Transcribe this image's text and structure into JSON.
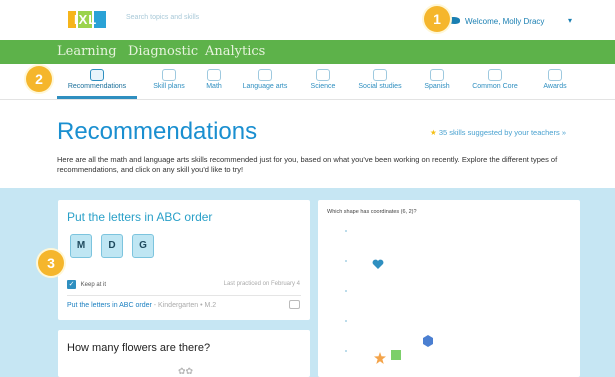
{
  "header": {
    "logo_text": "IXL",
    "search_placeholder": "Search topics and skills",
    "welcome_text": "Welcome, Molly Dracy",
    "caret": "▾"
  },
  "nav": {
    "items": [
      "Learning",
      "Diagnostic",
      "Analytics"
    ]
  },
  "subjects": {
    "items": [
      {
        "label": "Recommendations",
        "icon": "recommendations-icon"
      },
      {
        "label": "Skill plans",
        "icon": "skill-plans-icon"
      },
      {
        "label": "Math",
        "icon": "math-icon"
      },
      {
        "label": "Language arts",
        "icon": "language-arts-icon"
      },
      {
        "label": "Science",
        "icon": "science-icon"
      },
      {
        "label": "Social studies",
        "icon": "social-studies-icon"
      },
      {
        "label": "Spanish",
        "icon": "spanish-icon"
      },
      {
        "label": "Common Core",
        "icon": "common-core-icon"
      },
      {
        "label": "Awards",
        "icon": "awards-icon"
      }
    ]
  },
  "hero": {
    "title": "Recommendations",
    "suggested": "35 skills suggested by your teachers",
    "intro": "Here are all the math and language arts skills recommended just for you, based on what you've been working on recently. Explore the different types of recommendations, and click on any skill you'd like to try!"
  },
  "card1": {
    "title": "Put the letters in ABC order",
    "tiles": [
      "M",
      "D",
      "G"
    ],
    "keep_label": "Keep at it",
    "last_used": "Last practiced on February 4",
    "skill_link": "Put the letters in ABC order",
    "skill_sub": "- Kindergarten • M.2"
  },
  "card2": {
    "title": "How many flowers are there?"
  },
  "card3": {
    "question": "Which shape has coordinates (6, 2)?"
  },
  "callouts": [
    "1",
    "2",
    "3"
  ],
  "colors": {
    "brand_green": "#5db24a",
    "brand_blue": "#1a8fd0",
    "callout_orange": "#f5b62c",
    "light_blue_bg": "#c6e6f3"
  }
}
